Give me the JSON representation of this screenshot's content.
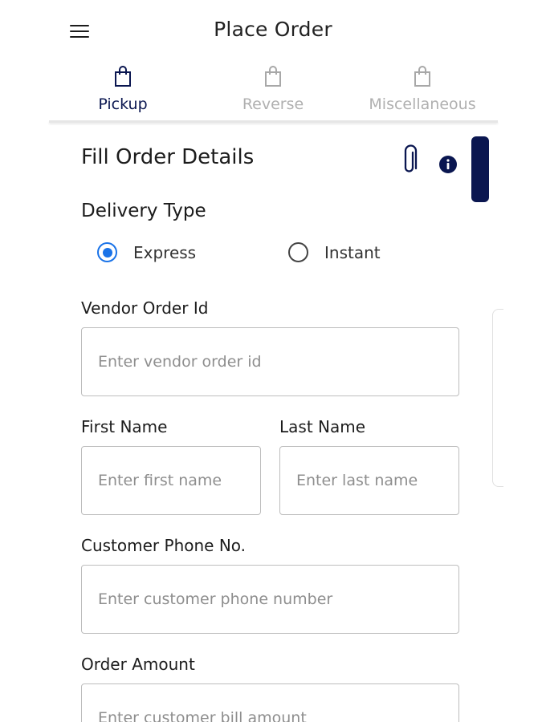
{
  "header": {
    "title": "Place Order",
    "menu_icon": "hamburger-menu-icon"
  },
  "tabs": [
    {
      "label": "Pickup",
      "icon": "shopping-bag-icon",
      "active": true
    },
    {
      "label": "Reverse",
      "icon": "shopping-bag-icon",
      "active": false
    },
    {
      "label": "Miscellaneous",
      "icon": "shopping-bag-icon",
      "active": false
    }
  ],
  "form": {
    "title": "Fill Order Details",
    "attach_icon": "paperclip-icon",
    "info_icon": "info-icon",
    "delivery_type": {
      "label": "Delivery Type",
      "options": [
        {
          "label": "Express",
          "selected": true
        },
        {
          "label": "Instant",
          "selected": false
        }
      ]
    },
    "vendor_order_id": {
      "label": "Vendor Order Id",
      "placeholder": "Enter vendor order id",
      "value": ""
    },
    "first_name": {
      "label": "First Name",
      "placeholder": "Enter first name",
      "value": ""
    },
    "last_name": {
      "label": "Last Name",
      "placeholder": "Enter last name",
      "value": ""
    },
    "customer_phone": {
      "label": "Customer Phone No.",
      "placeholder": "Enter customer phone number",
      "value": ""
    },
    "order_amount": {
      "label": "Order Amount",
      "placeholder": "Enter customer bill amount",
      "value": ""
    }
  },
  "colors": {
    "primary": "#0a1650",
    "radio_selected": "#1a73e8",
    "inactive_tab": "#b0b0b0",
    "input_border": "#bdbdbd"
  }
}
